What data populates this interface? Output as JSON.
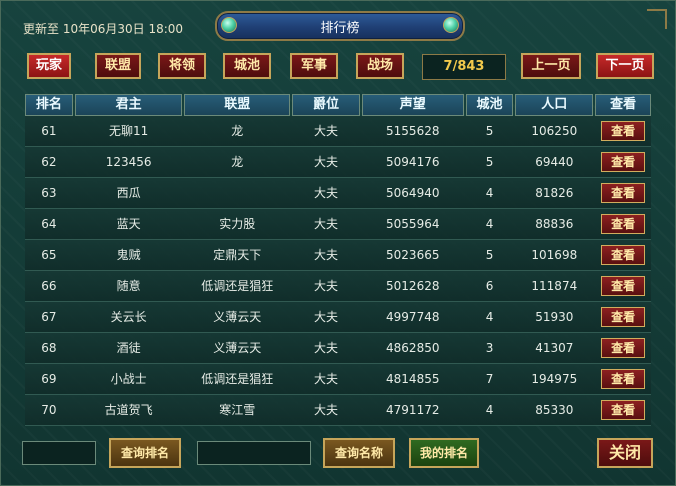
{
  "header": {
    "update_text": "更新至 10年06月30日 18:00",
    "title": "排行榜"
  },
  "tabs": [
    "玩家",
    "联盟",
    "将领",
    "城池",
    "军事",
    "战场"
  ],
  "pagination": {
    "page_info": "7/843",
    "prev_label": "上一页",
    "next_label": "下一页"
  },
  "table": {
    "headers": [
      "排名",
      "君主",
      "联盟",
      "爵位",
      "声望",
      "城池",
      "人口",
      "查看"
    ],
    "view_label": "查看",
    "rows": [
      [
        "61",
        "无聊11",
        "龙",
        "大夫",
        "5155628",
        "5",
        "106250"
      ],
      [
        "62",
        "123456",
        "龙",
        "大夫",
        "5094176",
        "5",
        "69440"
      ],
      [
        "63",
        "西瓜",
        "",
        "大夫",
        "5064940",
        "4",
        "81826"
      ],
      [
        "64",
        "蓝天",
        "实力股",
        "大夫",
        "5055964",
        "4",
        "88836"
      ],
      [
        "65",
        "鬼贼",
        "定鼎天下",
        "大夫",
        "5023665",
        "5",
        "101698"
      ],
      [
        "66",
        "随意",
        "低调还是猖狂",
        "大夫",
        "5012628",
        "6",
        "111874"
      ],
      [
        "67",
        "关云长",
        "义薄云天",
        "大夫",
        "4997748",
        "4",
        "51930"
      ],
      [
        "68",
        "酒徒",
        "义薄云天",
        "大夫",
        "4862850",
        "3",
        "41307"
      ],
      [
        "69",
        "小战士",
        "低调还是猖狂",
        "大夫",
        "4814855",
        "7",
        "194975"
      ],
      [
        "70",
        "古道贺飞",
        "寒江雪",
        "大夫",
        "4791172",
        "4",
        "85330"
      ]
    ]
  },
  "footer": {
    "search_rank_label": "查询排名",
    "search_name_label": "查询名称",
    "my_rank_label": "我的排名",
    "close_label": "关闭"
  }
}
